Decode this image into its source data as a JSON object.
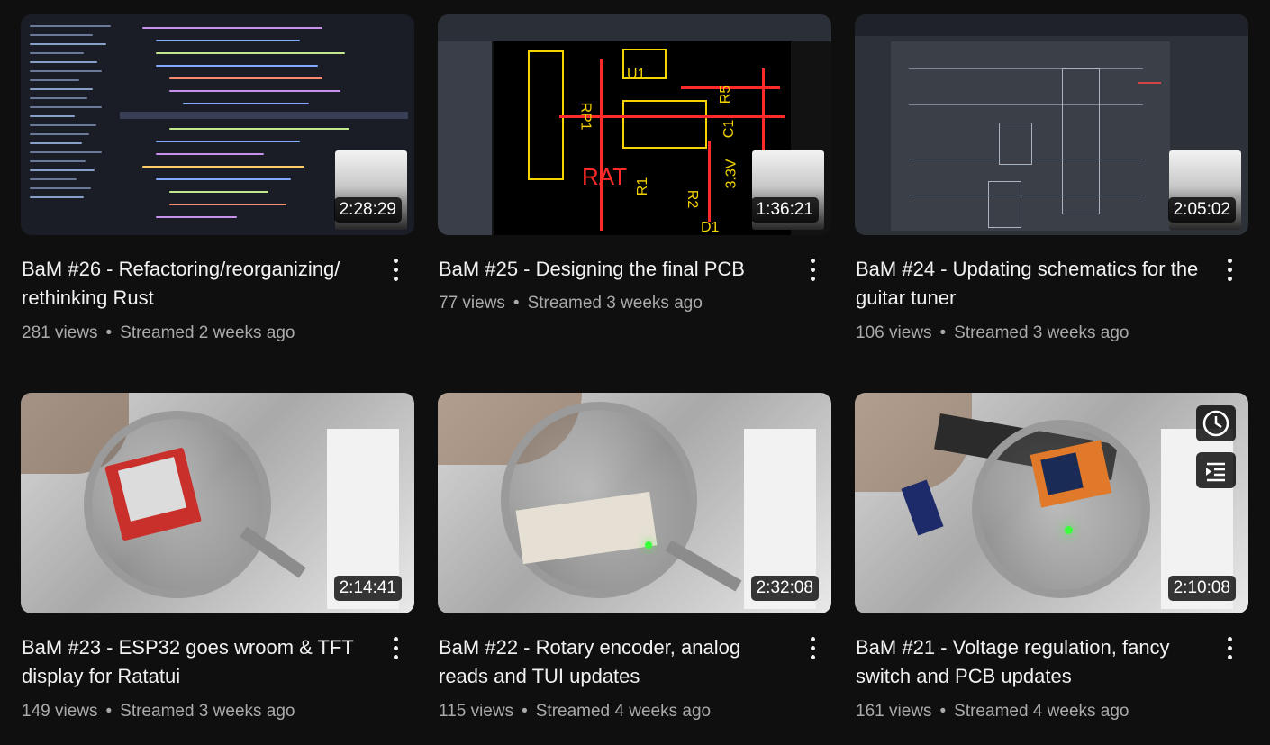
{
  "videos": [
    {
      "title": "BaM #26 - Refactoring/reorganizing/ rethinking Rust",
      "views": "281 views",
      "streamed": "Streamed 2 weeks ago",
      "duration": "2:28:29"
    },
    {
      "title": "BaM #25 - Designing the final PCB",
      "views": "77 views",
      "streamed": "Streamed 3 weeks ago",
      "duration": "1:36:21"
    },
    {
      "title": "BaM #24 - Updating schematics for the guitar tuner",
      "views": "106 views",
      "streamed": "Streamed 3 weeks ago",
      "duration": "2:05:02"
    },
    {
      "title": "BaM #23 - ESP32 goes wroom & TFT display for Ratatui",
      "views": "149 views",
      "streamed": "Streamed 3 weeks ago",
      "duration": "2:14:41"
    },
    {
      "title": "BaM #22 - Rotary encoder, analog reads and TUI updates",
      "views": "115 views",
      "streamed": "Streamed 4 weeks ago",
      "duration": "2:32:08"
    },
    {
      "title": "BaM #21 - Voltage regulation, fancy switch and PCB updates",
      "views": "161 views",
      "streamed": "Streamed 4 weeks ago",
      "duration": "2:10:08"
    }
  ],
  "separator": "•",
  "hover_actions": {
    "watch_later_icon": "clock-icon",
    "add_to_queue_icon": "queue-icon"
  },
  "pcb_labels": {
    "u1": "U1",
    "rp1": "RP1",
    "rat": "RAT",
    "r5": "R5",
    "c1": "C1",
    "r1": "R1",
    "r2": "R2",
    "v33": "3.3V",
    "d1": "D1"
  },
  "colors": {
    "background": "#0f0f0f",
    "title": "#f1f1f1",
    "meta": "#aaaaaa"
  }
}
